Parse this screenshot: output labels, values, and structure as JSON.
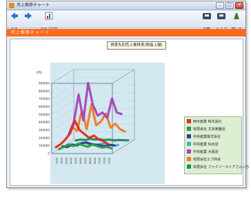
{
  "window": {
    "title": "売上推移チャート",
    "controls": [
      "–",
      "□",
      "×"
    ]
  },
  "toolbar": {
    "left": [
      {
        "label": "戻る",
        "icon": "back-arrow-icon"
      },
      {
        "label": "",
        "icon": "forward-arrow-icon"
      },
      {
        "label": "グラフ設定",
        "icon": "chart-settings-icon"
      }
    ],
    "right": [
      {
        "label": "印刷",
        "icon": "print-icon"
      },
      {
        "label": "ヘルプ",
        "icon": "help-icon"
      },
      {
        "label": "閉じる",
        "icon": "close-app-icon"
      }
    ]
  },
  "tab": {
    "label": "売上推移チャート"
  },
  "chart_data": {
    "type": "line",
    "title": "得意先別売上推移表(税抜上額)",
    "ylabel": "(円)",
    "ylim": [
      0,
      900000
    ],
    "yticks": [
      0,
      100000,
      200000,
      300000,
      400000,
      500000,
      600000,
      700000,
      800000,
      900000
    ],
    "x": [
      "0601",
      "0602",
      "0603",
      "0604",
      "0605",
      "0606",
      "0607",
      "0608",
      "0609",
      "0610",
      "0611",
      "0612"
    ],
    "series": [
      {
        "name": "西木産業 株式会社",
        "color": "#e02a20",
        "values": [
          80000,
          120000,
          180000,
          260000,
          420000,
          300000,
          250000,
          200000,
          230000,
          180000,
          160000,
          120000
        ]
      },
      {
        "name": "有限会社 文京楽器店",
        "color": "#2e9a3c",
        "values": [
          30000,
          60000,
          90000,
          70000,
          100000,
          80000,
          60000,
          90000,
          70000,
          50000,
          60000,
          40000
        ]
      },
      {
        "name": "中央産業株式会社",
        "color": "#2c3c96",
        "values": [
          40000,
          30000,
          60000,
          50000,
          80000,
          90000,
          70000,
          60000,
          50000,
          40000,
          60000,
          50000
        ]
      },
      {
        "name": "中央産業 仙台店",
        "color": "#3fb3c0",
        "values": [
          20000,
          40000,
          30000,
          50000,
          60000,
          40000,
          30000,
          40000,
          50000,
          30000,
          20000,
          30000
        ]
      },
      {
        "name": "中央産業 大阪店",
        "color": "#a445b8",
        "values": [
          150000,
          300000,
          650000,
          320000,
          800000,
          520000,
          380000,
          420000,
          350000,
          600000,
          420000,
          400000
        ]
      },
      {
        "name": "有限会社エフ商会",
        "color": "#ef7b22",
        "values": [
          200000,
          160000,
          420000,
          180000,
          500000,
          230000,
          280000,
          380000,
          200000,
          250000,
          180000,
          150000
        ]
      },
      {
        "name": "有限会社 ファミリーストアさんいち",
        "color": "#1e8a5a",
        "values": [
          10000,
          20000,
          15000,
          30000,
          20000,
          25000,
          15000,
          20000,
          10000,
          15000,
          12000,
          10000
        ]
      }
    ]
  }
}
